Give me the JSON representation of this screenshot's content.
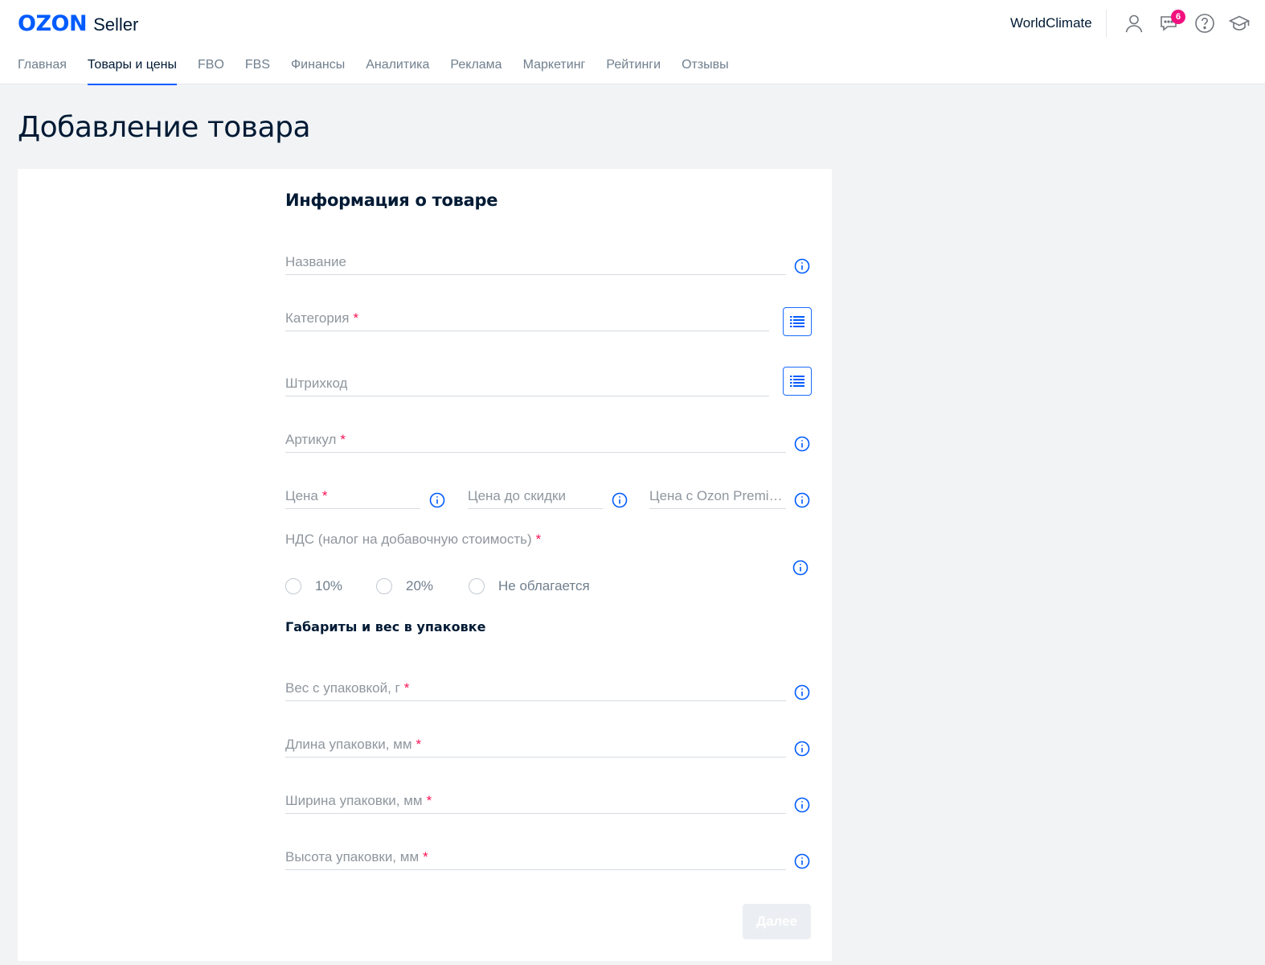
{
  "header": {
    "logo_brand": "OZON",
    "logo_product": "Seller",
    "account_name": "WorldClimate",
    "notifications_badge": "6",
    "icons": [
      "user-icon",
      "chat-icon",
      "help-icon",
      "education-icon"
    ]
  },
  "nav": {
    "items": [
      {
        "label": "Главная"
      },
      {
        "label": "Товары и цены"
      },
      {
        "label": "FBO"
      },
      {
        "label": "FBS"
      },
      {
        "label": "Финансы"
      },
      {
        "label": "Аналитика"
      },
      {
        "label": "Реклама"
      },
      {
        "label": "Маркетинг"
      },
      {
        "label": "Рейтинги"
      },
      {
        "label": "Отзывы"
      }
    ],
    "active": "Товары и цены"
  },
  "page": {
    "title": "Добавление товара"
  },
  "form": {
    "section_title": "Информация о товаре",
    "required_mark": "*",
    "fields": {
      "name": {
        "label": "Название",
        "value": ""
      },
      "category": {
        "label": "Категория",
        "value": ""
      },
      "barcode": {
        "label": "Штрихкод",
        "value": ""
      },
      "article": {
        "label": "Артикул",
        "value": ""
      },
      "price": {
        "label": "Цена",
        "value": ""
      },
      "old_price": {
        "label": "Цена до скидки",
        "value": ""
      },
      "premium_price": {
        "label": "Цена с Ozon Premium",
        "value": ""
      }
    },
    "vat": {
      "label": "НДС (налог на добавочную стоимость)",
      "options": [
        "10%",
        "20%",
        "Не облагается"
      ],
      "selected": ""
    },
    "dimensions_title": "Габариты и вес в упаковке",
    "dimensions": {
      "weight": {
        "label": "Вес с упаковкой, г",
        "value": ""
      },
      "length": {
        "label": "Длина упаковки, мм",
        "value": ""
      },
      "width": {
        "label": "Ширина упаковки, мм",
        "value": ""
      },
      "height": {
        "label": "Высота упаковки, мм",
        "value": ""
      }
    },
    "next_button": "Далее"
  },
  "colors": {
    "brand": "#005bff",
    "required": "#f91155",
    "badge": "#f1117e",
    "page_bg": "#f2f3f5"
  }
}
